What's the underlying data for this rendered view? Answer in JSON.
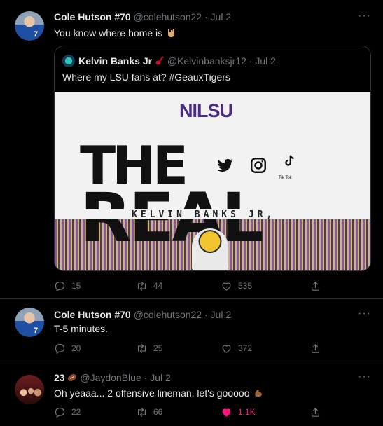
{
  "tweets": [
    {
      "name": "Cole Hutson #70",
      "handle": "@colehutson22",
      "time": "· Jul 2",
      "text": "You know where home is",
      "emoji": "rock-on-hand-emoji",
      "quote": {
        "name": "Kelvin Banks Jr",
        "handle": "@Kelvinbanksjr12",
        "time": "· Jul 2",
        "text": "Where my LSU fans at? #GeauxTigers",
        "media": {
          "brand": "NILSU",
          "headline_top": "THE",
          "headline_bottom": "REAL",
          "subtitle": "KELVIN BANKS JR,",
          "tiktok_label": "Tik Tok",
          "brand_color": "#4b2a82"
        }
      },
      "actions": {
        "replies": "15",
        "retweets": "44",
        "likes": "535"
      }
    },
    {
      "name": "Cole Hutson #70",
      "handle": "@colehutson22",
      "time": "· Jul 2",
      "text": "T-5 minutes.",
      "actions": {
        "replies": "20",
        "retweets": "25",
        "likes": "372"
      }
    },
    {
      "name": "23",
      "handle": "@JaydonBlue",
      "time": "· Jul 2",
      "text": "Oh yeaaa... 2 offensive lineman, let's gooooo",
      "emoji": "flexed-biceps-emoji",
      "actions": {
        "replies": "22",
        "retweets": "66",
        "likes": "1.1K",
        "liked": true
      }
    }
  ],
  "more_label": "···",
  "colors": {
    "background": "#000000",
    "text": "#e7e9ea",
    "muted": "#71767b",
    "like": "#f91880",
    "border": "#2f3336"
  }
}
